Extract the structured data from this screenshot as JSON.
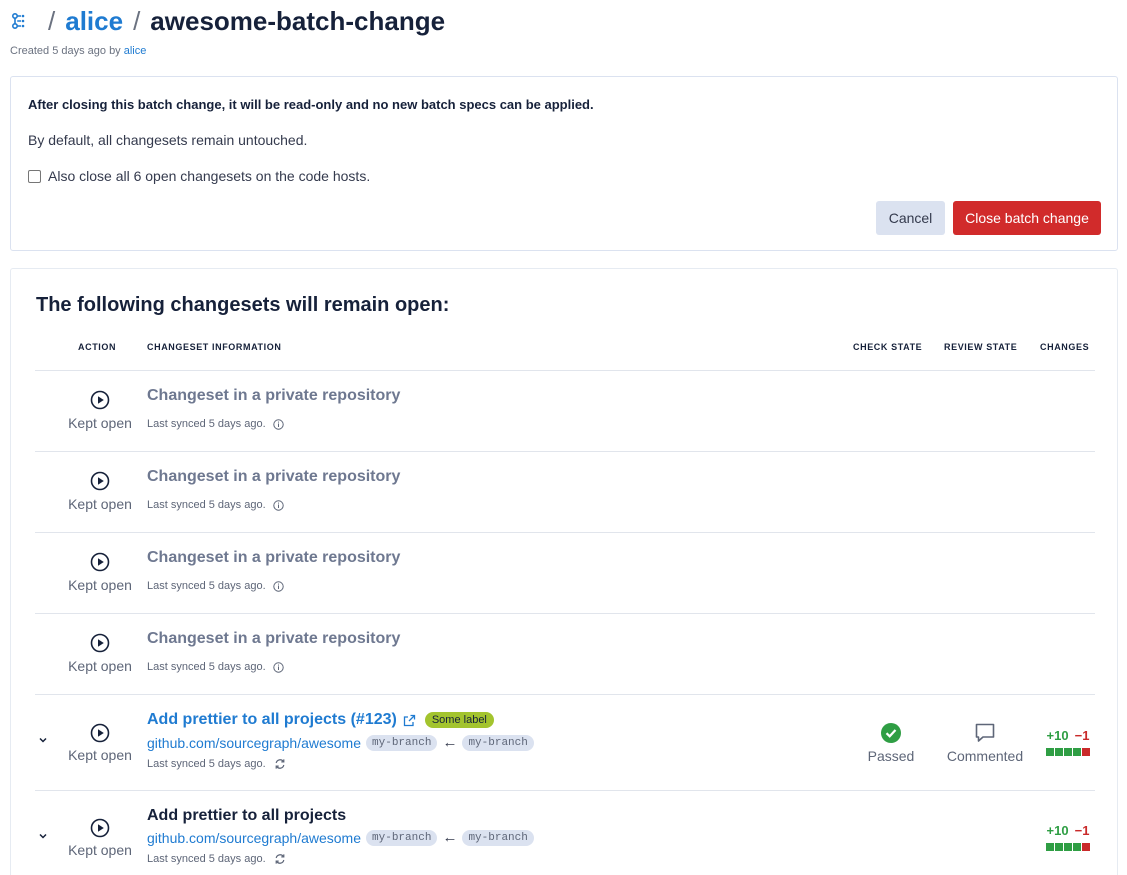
{
  "breadcrumb": {
    "separator": "/",
    "namespace": "alice",
    "batch_change_name": "awesome-batch-change",
    "icon": "batch-changes-icon"
  },
  "created": {
    "prefix": "Created 5 days ago by",
    "author": "alice"
  },
  "close_panel": {
    "warning": "After closing this batch change, it will be read-only and no new batch specs can be applied.",
    "default_text": "By default, all changesets remain untouched.",
    "checkbox_label": "Also close all 6 open changesets on the code hosts.",
    "checkbox_checked": false,
    "cancel_label": "Cancel",
    "close_label": "Close batch change",
    "close_color": "#d12b2b"
  },
  "changesets": {
    "heading": "The following changesets will remain open:",
    "columns": [
      "ACTION",
      "CHANGESET INFORMATION",
      "CHECK STATE",
      "REVIEW STATE",
      "CHANGES"
    ],
    "private_rows": [
      {
        "action": "Kept open",
        "title": "Changeset in a private repository",
        "synced": "Last synced 5 days ago."
      },
      {
        "action": "Kept open",
        "title": "Changeset in a private repository",
        "synced": "Last synced 5 days ago."
      },
      {
        "action": "Kept open",
        "title": "Changeset in a private repository",
        "synced": "Last synced 5 days ago."
      },
      {
        "action": "Kept open",
        "title": "Changeset in a private repository",
        "synced": "Last synced 5 days ago."
      }
    ],
    "visible_rows": [
      {
        "action": "Kept open",
        "title": "Add prettier to all projects (#123)",
        "label": "Some label",
        "label_color": "#a3c42e",
        "repo": "github.com/sourcegraph/awesome",
        "head_branch": "my-branch",
        "base_branch": "my-branch",
        "arrow": "←",
        "synced": "Last synced 5 days ago.",
        "check_state": "Passed",
        "review_state": "Commented",
        "added": "+10",
        "deleted": "−1"
      },
      {
        "action": "Kept open",
        "title": "Add prettier to all projects",
        "repo": "github.com/sourcegraph/awesome",
        "head_branch": "my-branch",
        "base_branch": "my-branch",
        "arrow": "←",
        "synced": "Last synced 5 days ago.",
        "added": "+10",
        "deleted": "−1"
      }
    ],
    "diff_colors": {
      "added": "#2f9e44",
      "deleted": "#c92a2a"
    }
  }
}
